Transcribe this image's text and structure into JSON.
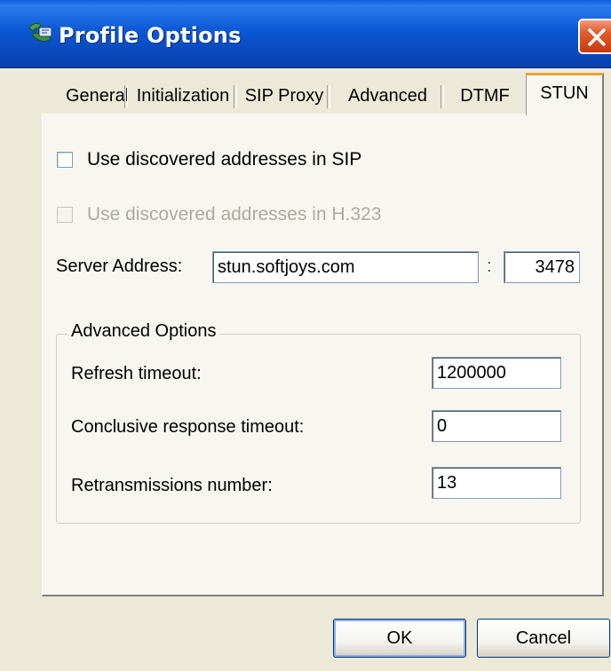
{
  "window": {
    "title": "Profile Options"
  },
  "tabs": [
    {
      "label": "General"
    },
    {
      "label": "Initialization"
    },
    {
      "label": "SIP Proxy"
    },
    {
      "label": "Advanced"
    },
    {
      "label": "DTMF"
    },
    {
      "label": "STUN",
      "active": true
    }
  ],
  "stun": {
    "use_sip_label": "Use discovered addresses in SIP",
    "use_sip_checked": false,
    "use_h323_label": "Use discovered addresses in H.323",
    "use_h323_checked": false,
    "use_h323_enabled": false,
    "server_address_label": "Server Address:",
    "server_address_value": "stun.softjoys.com",
    "port_separator": ":",
    "port_value": "3478"
  },
  "advanced_options": {
    "title": "Advanced Options",
    "refresh_timeout_label": "Refresh timeout:",
    "refresh_timeout_value": "1200000",
    "conclusive_timeout_label": "Conclusive response timeout:",
    "conclusive_timeout_value": "0",
    "retransmissions_label": "Retransmissions number:",
    "retransmissions_value": "13"
  },
  "buttons": {
    "ok": "OK",
    "cancel": "Cancel"
  },
  "icons": {
    "app": "phone-icon",
    "close": "close-icon"
  },
  "colors": {
    "titlebar": "#0b58d4",
    "close_button": "#e05a2b",
    "tab_highlight": "#e8a33a",
    "dialog_bg": "#ece9d8"
  }
}
